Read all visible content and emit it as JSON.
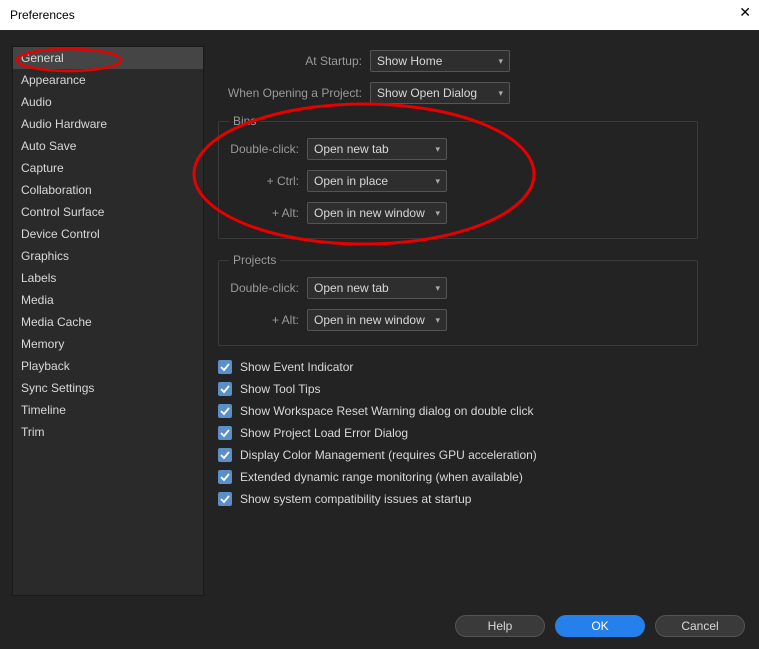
{
  "window": {
    "title": "Preferences"
  },
  "sidebar": {
    "items": [
      {
        "label": "General",
        "selected": true
      },
      {
        "label": "Appearance"
      },
      {
        "label": "Audio"
      },
      {
        "label": "Audio Hardware"
      },
      {
        "label": "Auto Save"
      },
      {
        "label": "Capture"
      },
      {
        "label": "Collaboration"
      },
      {
        "label": "Control Surface"
      },
      {
        "label": "Device Control"
      },
      {
        "label": "Graphics"
      },
      {
        "label": "Labels"
      },
      {
        "label": "Media"
      },
      {
        "label": "Media Cache"
      },
      {
        "label": "Memory"
      },
      {
        "label": "Playback"
      },
      {
        "label": "Sync Settings"
      },
      {
        "label": "Timeline"
      },
      {
        "label": "Trim"
      }
    ]
  },
  "main": {
    "at_startup_label": "At Startup:",
    "at_startup_value": "Show Home",
    "open_project_label": "When Opening a Project:",
    "open_project_value": "Show Open Dialog",
    "bins": {
      "legend": "Bins",
      "dblclick_label": "Double-click:",
      "dblclick_value": "Open new tab",
      "ctrl_label": "+ Ctrl:",
      "ctrl_value": "Open in place",
      "alt_label": "+ Alt:",
      "alt_value": "Open in new window"
    },
    "projects": {
      "legend": "Projects",
      "dblclick_label": "Double-click:",
      "dblclick_value": "Open new tab",
      "alt_label": "+ Alt:",
      "alt_value": "Open in new window"
    },
    "checks": [
      "Show Event Indicator",
      "Show Tool Tips",
      "Show Workspace Reset Warning dialog on double click",
      "Show Project Load Error Dialog",
      "Display Color Management (requires GPU acceleration)",
      "Extended dynamic range monitoring (when available)",
      "Show system compatibility issues at startup"
    ]
  },
  "footer": {
    "help": "Help",
    "ok": "OK",
    "cancel": "Cancel"
  }
}
